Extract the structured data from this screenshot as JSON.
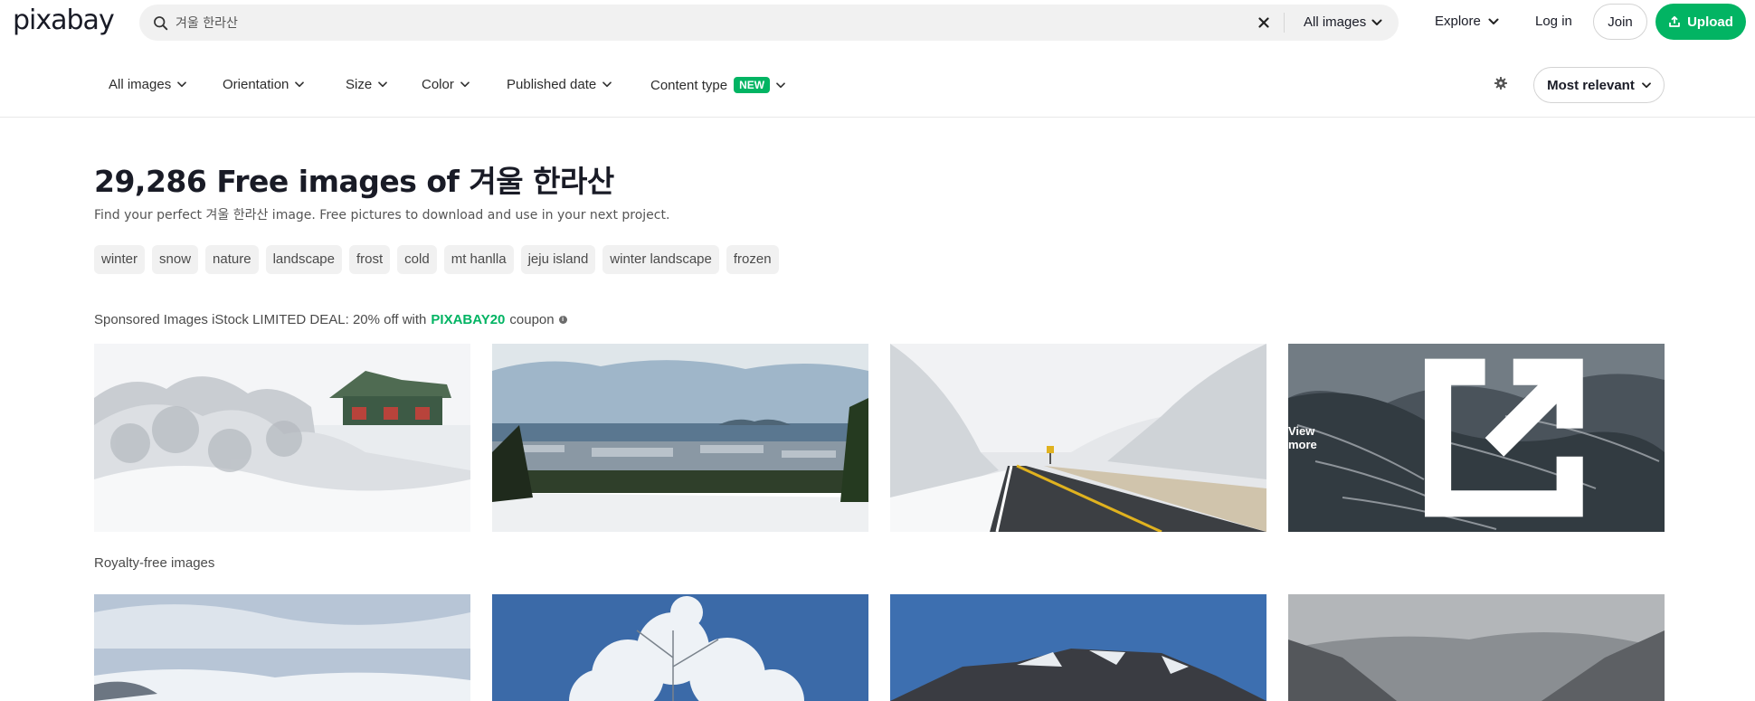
{
  "header": {
    "logo": "pixabay",
    "search": {
      "value": "겨울 한라산",
      "placeholder": ""
    },
    "search_type": "All images",
    "nav": {
      "explore": "Explore",
      "login": "Log in",
      "join": "Join",
      "upload": "Upload"
    }
  },
  "filters": {
    "items": [
      {
        "label": "All images"
      },
      {
        "label": "Orientation"
      },
      {
        "label": "Size"
      },
      {
        "label": "Color"
      },
      {
        "label": "Published date"
      },
      {
        "label": "Content type",
        "badge": "NEW"
      }
    ],
    "sort": "Most relevant"
  },
  "main": {
    "title": "29,286 Free images of 겨울 한라산",
    "subtitle": "Find your perfect 겨울 한라산 image. Free pictures to download and use in your next project.",
    "tags": [
      "winter",
      "snow",
      "nature",
      "landscape",
      "frost",
      "cold",
      "mt hanlla",
      "jeju island",
      "winter landscape",
      "frozen"
    ],
    "sponsored": {
      "prefix": "Sponsored Images iStock LIMITED DEAL: 20% off with",
      "code": "PIXABAY20",
      "suffix": "coupon"
    },
    "view_more": "View more",
    "royalty_label": "Royalty-free images"
  },
  "colors": {
    "brand": "#02b463",
    "text": "#191b26",
    "chip_bg": "#f1f1f1"
  }
}
